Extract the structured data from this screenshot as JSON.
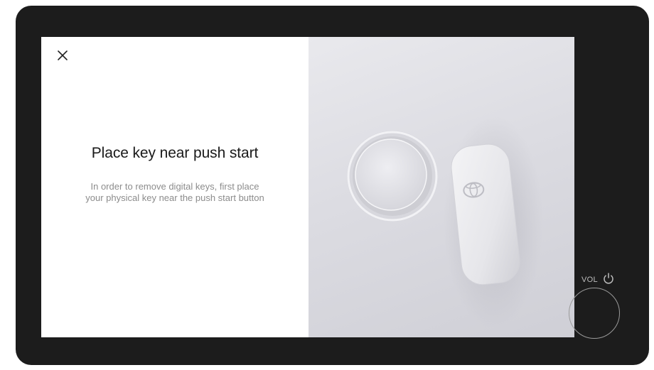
{
  "dialog": {
    "title": "Place key near push start",
    "message": "In order to remove digital keys, first place your physical key near the push start button",
    "close_icon": "close-icon"
  },
  "illustration": {
    "subjects": [
      "push-start-button",
      "key-fob"
    ]
  },
  "hardware": {
    "vol_label": "VOL",
    "power_icon": "power-icon"
  },
  "colors": {
    "bezel": "#1c1c1c",
    "title": "#1a1a1a",
    "message": "#8c8c8c"
  }
}
